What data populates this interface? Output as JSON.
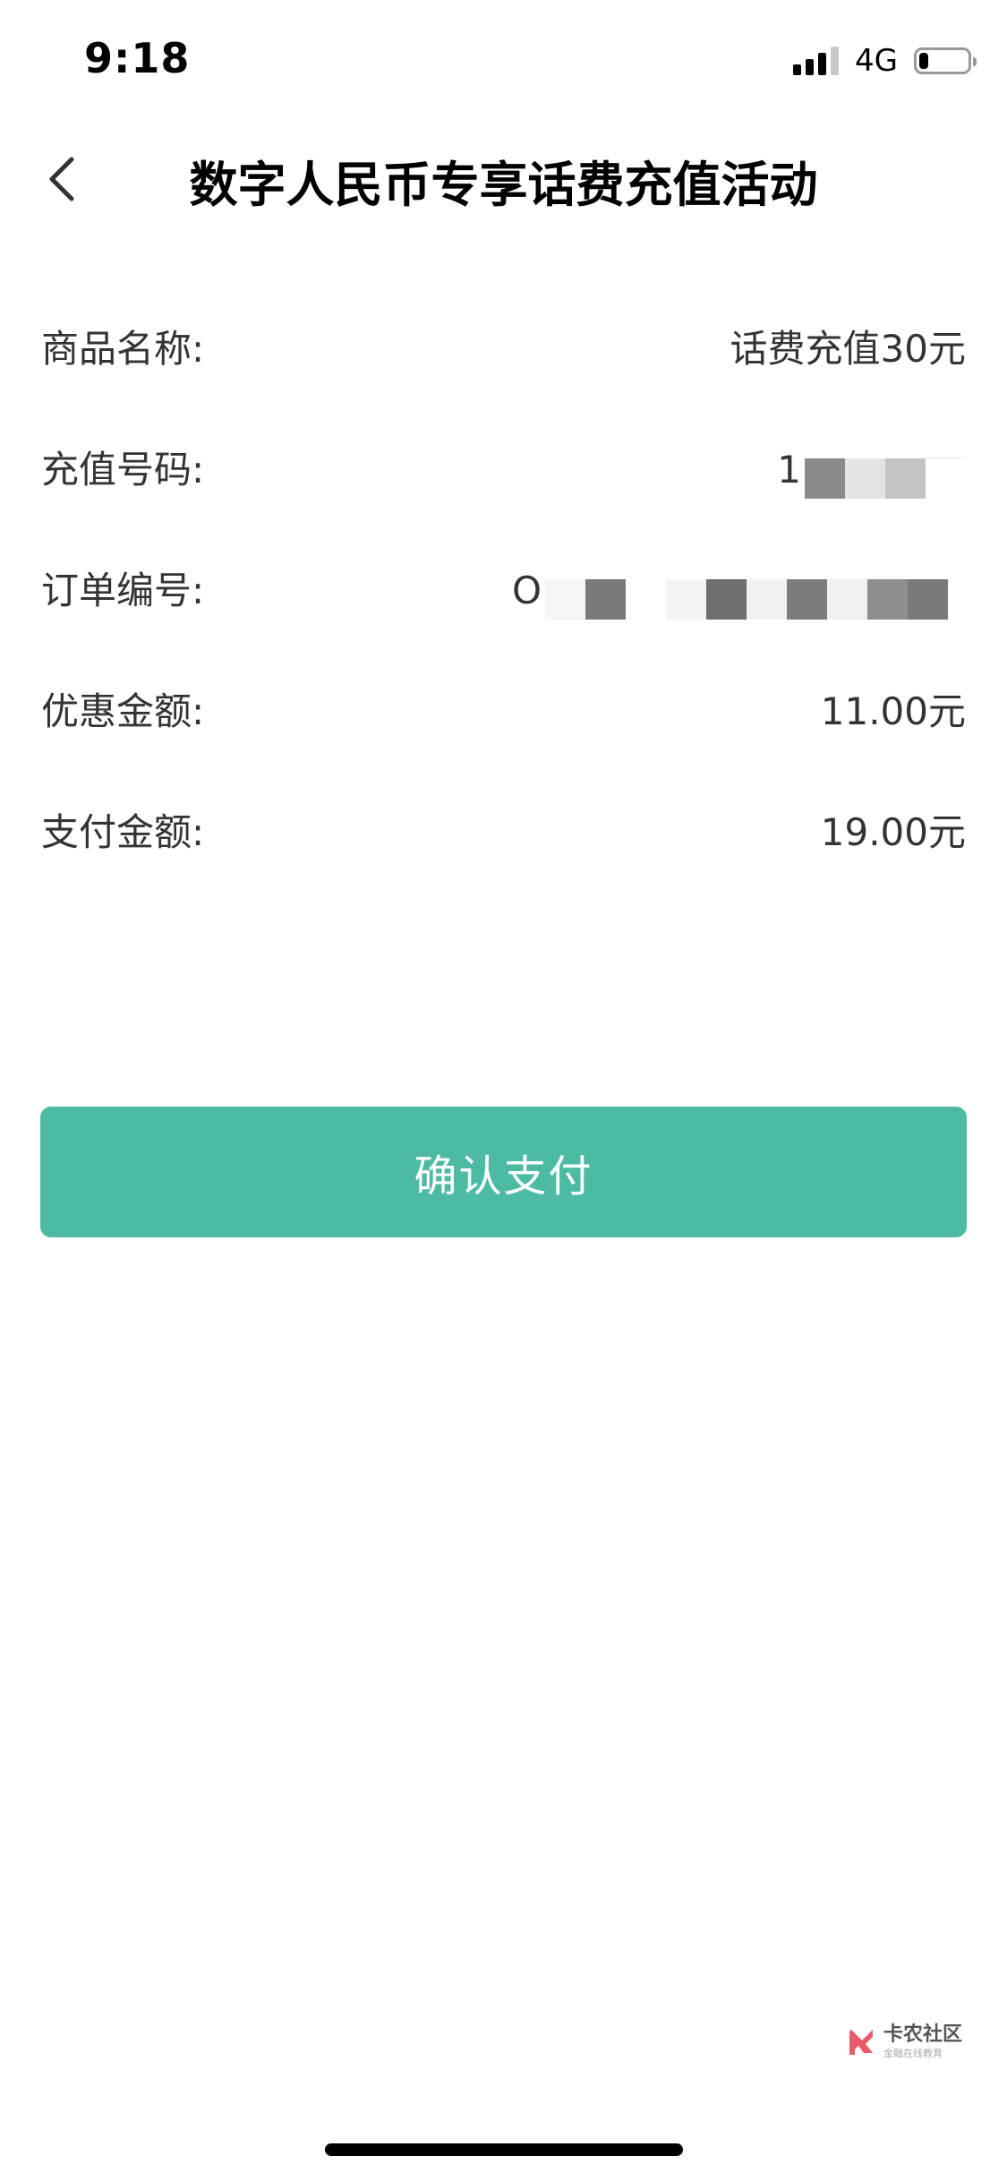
{
  "status_bar": {
    "time": "9:18",
    "network": "4G",
    "signal_bars_active": 3,
    "signal_bars_total": 4,
    "battery_level": 0.2
  },
  "nav": {
    "back_icon": "chevron-left-icon",
    "title": "数字人民币专享话费充值活动"
  },
  "order": {
    "rows": [
      {
        "label": "商品名称:",
        "value": "话费充值30元"
      },
      {
        "label": "充值号码:",
        "value": "1",
        "masked": true
      },
      {
        "label": "订单编号:",
        "value": "O",
        "masked": true
      },
      {
        "label": "优惠金额:",
        "value": "11.00元"
      },
      {
        "label": "支付金额:",
        "value": "19.00元"
      }
    ]
  },
  "confirm_button": {
    "label": "确认支付"
  },
  "watermark": {
    "main": "卡农社区",
    "sub": "金融在线教育"
  },
  "colors": {
    "accent": "#4dbba3",
    "text": "#333333",
    "background": "#ffffff"
  }
}
